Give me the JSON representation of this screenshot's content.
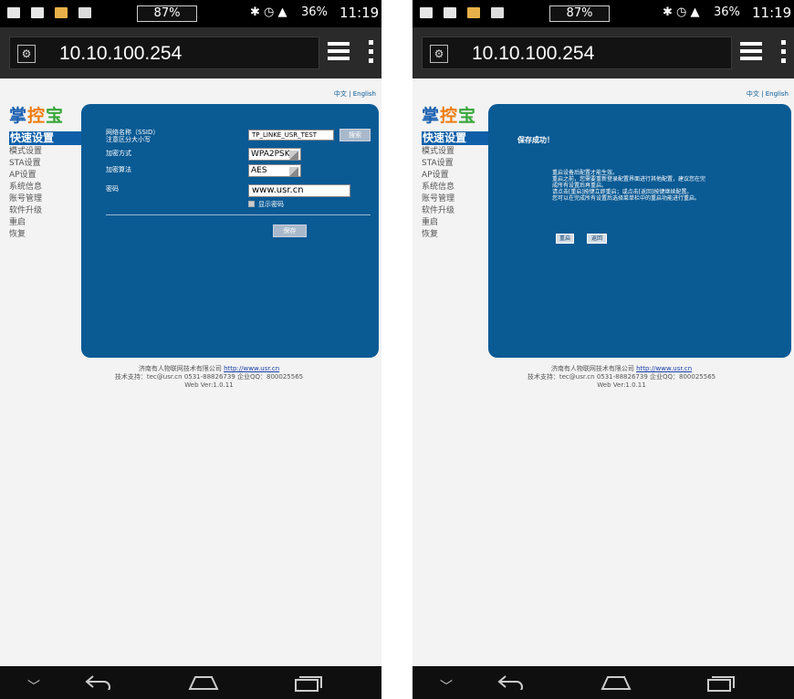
{
  "status": {
    "battery_box": "87%",
    "signal_text": "36%",
    "time": "11:19"
  },
  "browser": {
    "url": "10.10.100.254"
  },
  "page": {
    "lang_switch": "中文 | English",
    "logo": {
      "c1": "掌",
      "c2": "控",
      "c3": "宝"
    },
    "nav": [
      {
        "label": "快速设置",
        "active": true
      },
      {
        "label": "模式设置"
      },
      {
        "label": "STA设置"
      },
      {
        "label": "AP设置"
      },
      {
        "label": "系统信息"
      },
      {
        "label": "账号管理"
      },
      {
        "label": "软件升级"
      },
      {
        "label": "重启"
      },
      {
        "label": "恢复"
      }
    ],
    "form": {
      "ssid_label": "网络名称（SSID）",
      "ssid_note": "注意区分大小写",
      "ssid_value": "TP_LINKE_USR_TEST",
      "search_button": "搜索",
      "encryption_label": "加密方式",
      "encryption_value": "WPA2PSK",
      "algorithm_label": "加密算法",
      "algorithm_value": "AES",
      "password_label": "密码",
      "password_value": "www.usr.cn",
      "show_password": "显示密码",
      "save_button": "保存"
    },
    "success": {
      "title": "保存成功！",
      "lines": [
        "重启设备后配置才能生效。",
        "重启之前，您需要重新登录配置界面进行其他配置，建议您在完",
        "成所有设置后再重启。",
        "请点击[重启]按键立即重启；或点击[返回]按键继续配置。",
        "您可以在完成所有设置后选择菜单栏中的重启功能进行重启。"
      ],
      "restart_button": "重启",
      "back_button": "返回"
    },
    "footer": {
      "company": "济南有人物联网技术有限公司",
      "link": "http://www.usr.cn",
      "support": "技术支持：tec@usr.cn 0531-88826739 企业QQ：800025565",
      "version": "Web Ver:1.0.11"
    }
  }
}
